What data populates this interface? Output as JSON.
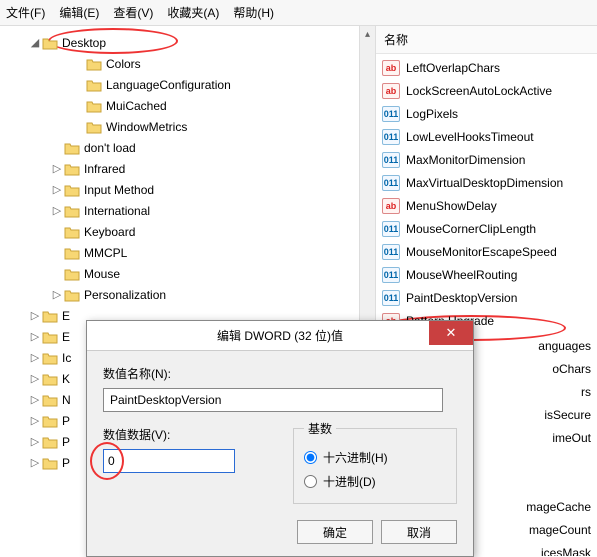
{
  "menu": {
    "file": "文件(F)",
    "edit": "编辑(E)",
    "view": "查看(V)",
    "fav": "收藏夹(A)",
    "help": "帮助(H)"
  },
  "tree": {
    "desktop": "Desktop",
    "colors": "Colors",
    "langcfg": "LanguageConfiguration",
    "muicached": "MuiCached",
    "winmetrics": "WindowMetrics",
    "dontload": "don't load",
    "infrared": "Infrared",
    "inputmethod": "Input Method",
    "intl": "International",
    "keyboard": "Keyboard",
    "mmcpl": "MMCPL",
    "mouse": "Mouse",
    "personalization": "Personalization",
    "cut": [
      "E",
      "E",
      "Ic",
      "K",
      "N",
      "P",
      "P",
      "P"
    ]
  },
  "list": {
    "header": "名称",
    "items": [
      {
        "k": "LeftOverlapChars",
        "t": "sz"
      },
      {
        "k": "LockScreenAutoLockActive",
        "t": "sz"
      },
      {
        "k": "LogPixels",
        "t": "num"
      },
      {
        "k": "LowLevelHooksTimeout",
        "t": "num"
      },
      {
        "k": "MaxMonitorDimension",
        "t": "num"
      },
      {
        "k": "MaxVirtualDesktopDimension",
        "t": "num"
      },
      {
        "k": "MenuShowDelay",
        "t": "sz"
      },
      {
        "k": "MouseCornerClipLength",
        "t": "num"
      },
      {
        "k": "MouseMonitorEscapeSpeed",
        "t": "num"
      },
      {
        "k": "MouseWheelRouting",
        "t": "num"
      },
      {
        "k": "PaintDesktopVersion",
        "t": "num"
      },
      {
        "k": "Pattern Upgrade",
        "t": "sz"
      }
    ],
    "partial": [
      "anguages",
      "oChars",
      "rs",
      "isSecure",
      "imeOut",
      "",
      "",
      "mageCache",
      "mageCount",
      "icesMask"
    ]
  },
  "dialog": {
    "title": "编辑 DWORD (32 位)值",
    "nameLabel": "数值名称(N):",
    "nameValue": "PaintDesktopVersion",
    "dataLabel": "数值数据(V):",
    "dataValue": "0",
    "baseLabel": "基数",
    "hex": "十六进制(H)",
    "dec": "十进制(D)",
    "ok": "确定",
    "cancel": "取消"
  },
  "icons": {
    "ab": "ab",
    "bin": "011"
  }
}
